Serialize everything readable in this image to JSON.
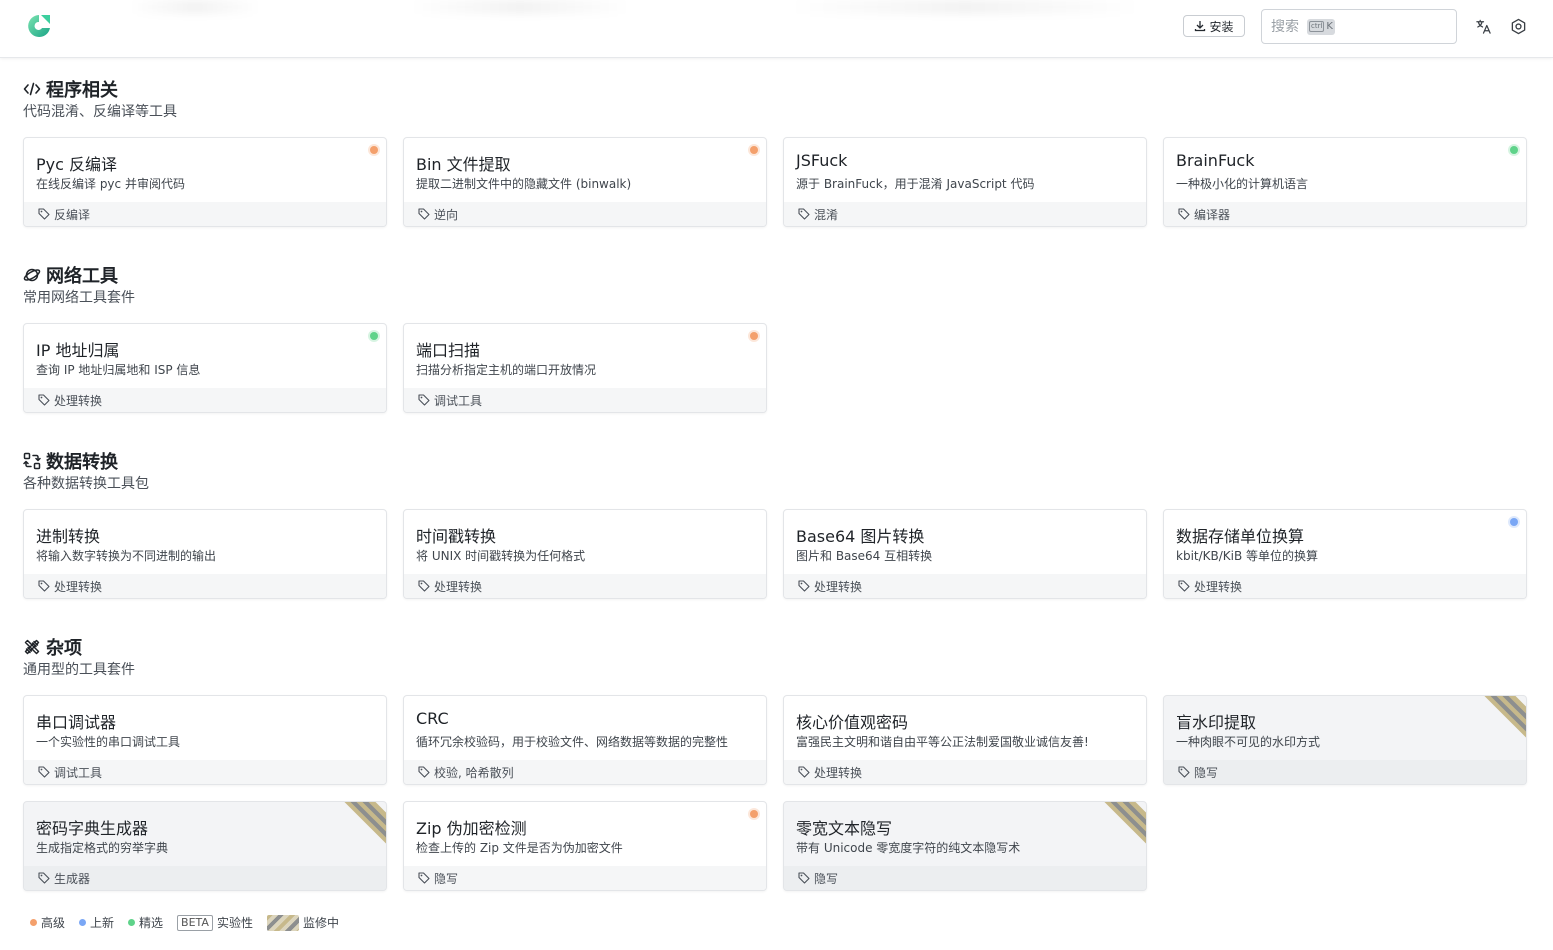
{
  "header": {
    "install_label": "安装",
    "search_placeholder": "搜索",
    "search_shortcut_ctrl": "ctrl",
    "search_shortcut_key": "K"
  },
  "colors": {
    "advanced": "#f4a06c",
    "new": "#7aa7f5",
    "featured": "#5fd38a",
    "monitoring_stripe": "#c7b98b"
  },
  "sections": [
    {
      "icon": "code-icon",
      "title": "程序相关",
      "subtitle": "代码混淆、反编译等工具",
      "cards": [
        {
          "title": "Pyc 反编译",
          "desc": "在线反编译 pyc 并审阅代码",
          "tag": "反编译",
          "badge": "advanced"
        },
        {
          "title": "Bin 文件提取",
          "desc": "提取二进制文件中的隐藏文件 (binwalk)",
          "tag": "逆向",
          "badge": "advanced"
        },
        {
          "title": "JSFuck",
          "desc": "源于 BrainFuck，用于混淆 JavaScript 代码",
          "tag": "混淆",
          "badge": ""
        },
        {
          "title": "BrainFuck",
          "desc": "一种极小化的计算机语言",
          "tag": "编译器",
          "badge": "featured"
        }
      ]
    },
    {
      "icon": "planet-icon",
      "title": "网络工具",
      "subtitle": "常用网络工具套件",
      "cards": [
        {
          "title": "IP 地址归属",
          "desc": "查询 IP 地址归属地和 ISP 信息",
          "tag": "处理转换",
          "badge": "featured"
        },
        {
          "title": "端口扫描",
          "desc": "扫描分析指定主机的端口开放情况",
          "tag": "调试工具",
          "badge": "advanced"
        }
      ]
    },
    {
      "icon": "convert-icon",
      "title": "数据转换",
      "subtitle": "各种数据转换工具包",
      "cards": [
        {
          "title": "进制转换",
          "desc": "将输入数字转换为不同进制的输出",
          "tag": "处理转换",
          "badge": ""
        },
        {
          "title": "时间戳转换",
          "desc": "将 UNIX 时间戳转换为任何格式",
          "tag": "处理转换",
          "badge": ""
        },
        {
          "title": "Base64 图片转换",
          "desc": "图片和 Base64 互相转换",
          "tag": "处理转换",
          "badge": ""
        },
        {
          "title": "数据存储单位换算",
          "desc": "kbit/KB/KiB 等单位的换算",
          "tag": "处理转换",
          "badge": "new"
        }
      ]
    },
    {
      "icon": "tools-icon",
      "title": "杂项",
      "subtitle": "通用型的工具套件",
      "cards": [
        {
          "title": "串口调试器",
          "desc": "一个实验性的串口调试工具",
          "tag": "调试工具",
          "badge": ""
        },
        {
          "title": "CRC",
          "desc": "循环冗余校验码，用于校验文件、网络数据等数据的完整性",
          "tag": "校验, 哈希散列",
          "badge": ""
        },
        {
          "title": "核心价值观密码",
          "desc": "富强民主文明和谐自由平等公正法制爱国敬业诚信友善!",
          "tag": "处理转换",
          "badge": ""
        },
        {
          "title": "盲水印提取",
          "desc": "一种肉眼不可见的水印方式",
          "tag": "隐写",
          "badge": "monitoring"
        },
        {
          "title": "密码字典生成器",
          "desc": "生成指定格式的穷举字典",
          "tag": "生成器",
          "badge": "monitoring"
        },
        {
          "title": "Zip 伪加密检测",
          "desc": "检查上传的 Zip 文件是否为伪加密文件",
          "tag": "隐写",
          "badge": "advanced"
        },
        {
          "title": "零宽文本隐写",
          "desc": "带有 Unicode 零宽度字符的纯文本隐写术",
          "tag": "隐写",
          "badge": "monitoring"
        }
      ]
    }
  ],
  "legend": {
    "advanced": "高级",
    "new": "上新",
    "featured": "精选",
    "beta_badge": "BETA",
    "beta": "实验性",
    "monitoring": "监修中"
  }
}
